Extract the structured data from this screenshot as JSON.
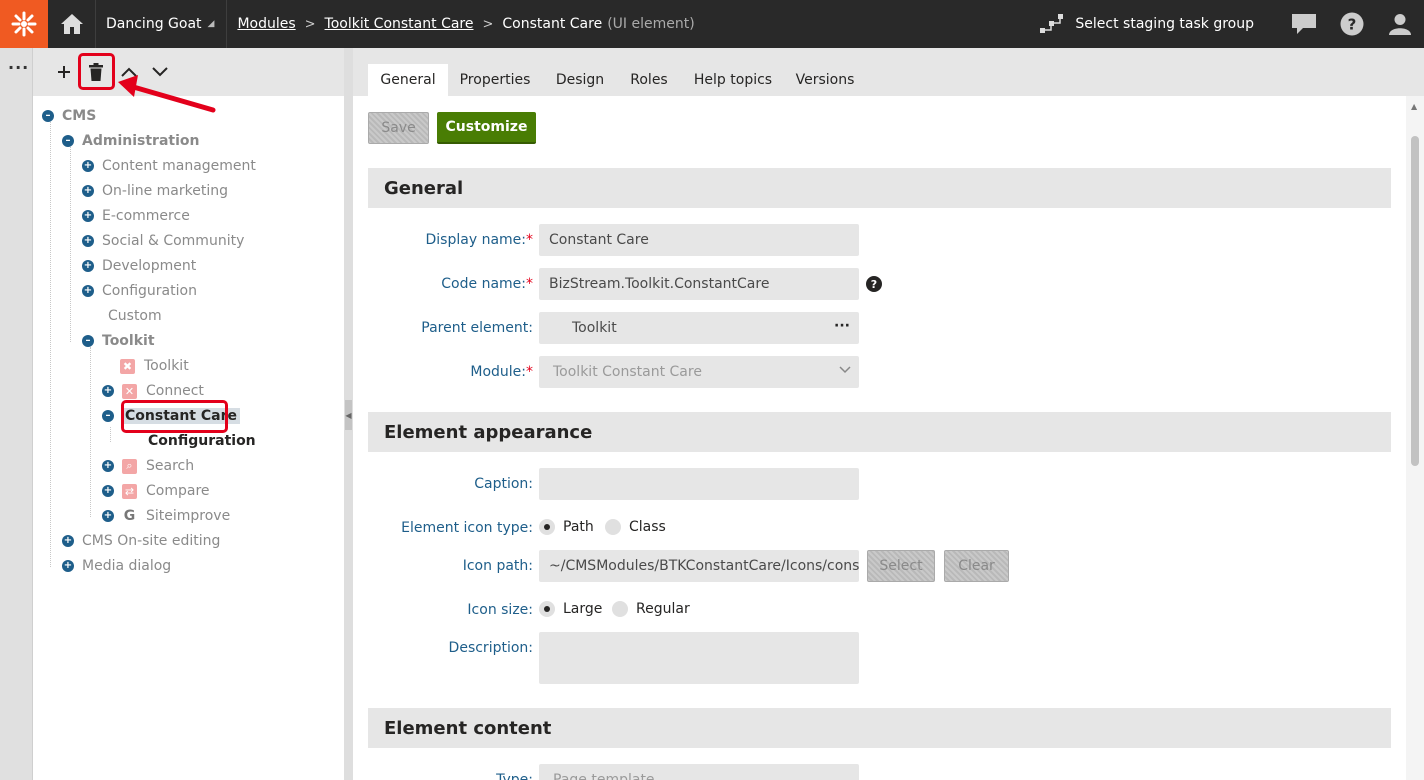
{
  "header": {
    "site_name": "Dancing Goat",
    "breadcrumbs": [
      {
        "label": "Modules"
      },
      {
        "label": "Toolkit Constant Care"
      }
    ],
    "current": "Constant Care",
    "current_type": "(UI element)",
    "staging_label": "Select staging task group",
    "colors": {
      "bar": "#292929",
      "logo_bg": "#f05a22"
    }
  },
  "tree": {
    "nodes": [
      {
        "label": "CMS"
      },
      {
        "label": "Administration"
      },
      {
        "label": "Content management"
      },
      {
        "label": "On-line marketing"
      },
      {
        "label": "E-commerce"
      },
      {
        "label": "Social & Community"
      },
      {
        "label": "Development"
      },
      {
        "label": "Configuration"
      },
      {
        "label": "Custom"
      },
      {
        "label": "Toolkit"
      },
      {
        "label": "Toolkit"
      },
      {
        "label": "Connect"
      },
      {
        "label": "Constant Care"
      },
      {
        "label": "Configuration"
      },
      {
        "label": "Search"
      },
      {
        "label": "Compare"
      },
      {
        "label": "Siteimprove"
      },
      {
        "label": "CMS On-site editing"
      },
      {
        "label": "Media dialog"
      }
    ]
  },
  "tabs": [
    {
      "label": "General"
    },
    {
      "label": "Properties"
    },
    {
      "label": "Design"
    },
    {
      "label": "Roles"
    },
    {
      "label": "Help topics"
    },
    {
      "label": "Versions"
    }
  ],
  "actions": {
    "save": "Save",
    "customize": "Customize"
  },
  "sections": {
    "general": "General",
    "appearance": "Element appearance",
    "content": "Element content"
  },
  "form": {
    "display_name": {
      "label": "Display name:",
      "required": "*",
      "value": "Constant Care"
    },
    "code_name": {
      "label": "Code name:",
      "required": "*",
      "value": "BizStream.Toolkit.ConstantCare"
    },
    "parent_element": {
      "label": "Parent element:",
      "value": "Toolkit",
      "more": "···"
    },
    "module": {
      "label": "Module:",
      "required": "*",
      "value": "Toolkit Constant Care"
    },
    "caption": {
      "label": "Caption:",
      "value": ""
    },
    "icon_type": {
      "label": "Element icon type:",
      "options": [
        "Path",
        "Class"
      ],
      "selected": "Path"
    },
    "icon_path": {
      "label": "Icon path:",
      "value": "~/CMSModules/BTKConstantCare/Icons/constan",
      "select": "Select",
      "clear": "Clear"
    },
    "icon_size": {
      "label": "Icon size:",
      "options": [
        "Large",
        "Regular"
      ],
      "selected": "Large"
    },
    "description": {
      "label": "Description:",
      "value": ""
    },
    "type": {
      "label": "Type:",
      "value": "Page template"
    }
  }
}
